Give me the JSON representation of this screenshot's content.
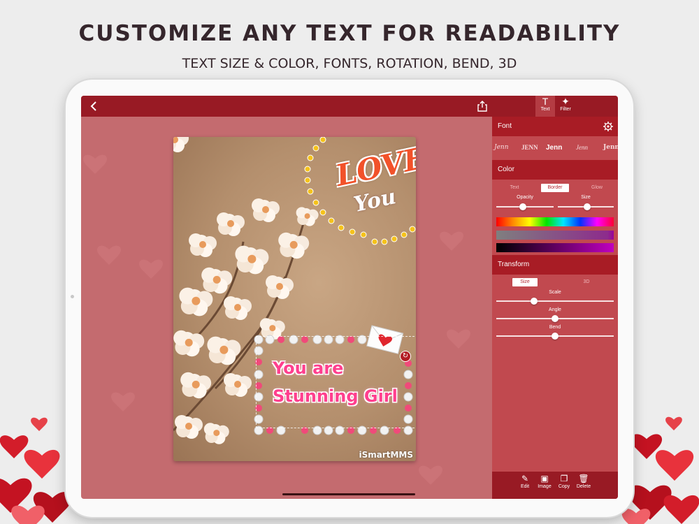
{
  "header": {
    "title": "CUSTOMIZE ANY TEXT FOR READABILITY",
    "subtitle": "TEXT SIZE & COLOR, FONTS, ROTATION, BEND, 3D"
  },
  "toolbar": {
    "text_label": "Text",
    "filter_label": "Filter"
  },
  "card": {
    "love_text": "LOVE",
    "you_text": "You",
    "message_line1": "You are",
    "message_line2": "Stunning Girl",
    "watermark": "iSmartMMS"
  },
  "panel": {
    "font_section": "Font",
    "font_samples": [
      "Jenn",
      "JENN",
      "Jenn",
      "Jenn",
      "Jenn"
    ],
    "color_section": "Color",
    "color_tabs": [
      "Text",
      "Border",
      "Glow"
    ],
    "color_tab_active": "Border",
    "opacity_label": "Opacity",
    "size_label": "Size",
    "opacity_value": 0.46,
    "border_size_value": 0.53,
    "transform_section": "Transform",
    "transform_tabs": [
      "Size",
      "3D"
    ],
    "transform_tab_active": "Size",
    "scale_label": "Scale",
    "angle_label": "Angle",
    "bend_label": "Bend",
    "scale_value": 0.32,
    "angle_value": 0.5,
    "bend_value": 0.5
  },
  "bottom_bar": {
    "edit": "Edit",
    "image": "Image",
    "copy": "Copy",
    "delete": "Delete"
  },
  "colors": {
    "brand_dark": "#981a24",
    "panel": "#c1494f",
    "canvas": "#c46b6f",
    "message_pink": "#ff3f8e",
    "love_orange": "#f2522a"
  }
}
